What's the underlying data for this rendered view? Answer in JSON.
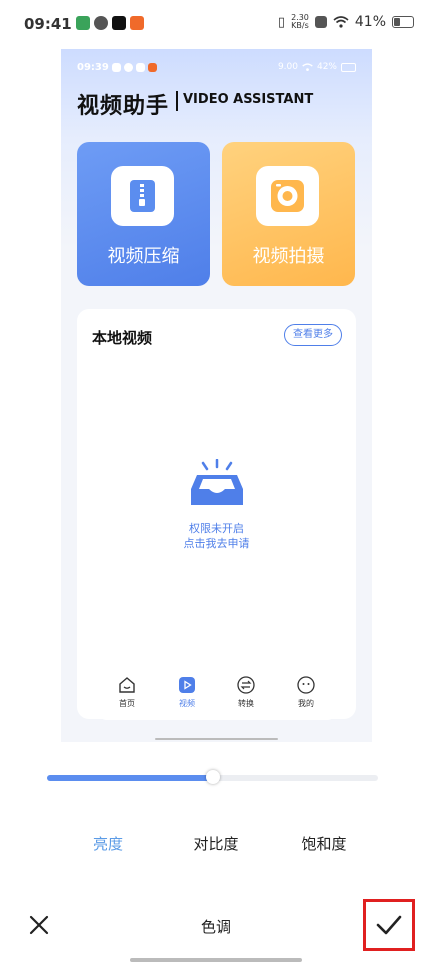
{
  "status_bar": {
    "time": "09:41",
    "net_speed_top": "2.30",
    "net_speed_bottom": "KB/s",
    "battery": "41%"
  },
  "preview": {
    "status_time": "09:39",
    "status_speed": "9.00",
    "status_battery": "42%",
    "app_title": "视频助手",
    "app_subtitle": "VIDEO ASSISTANT",
    "cards": [
      {
        "label": "视频压缩",
        "color": "#5b8def"
      },
      {
        "label": "视频拍摄",
        "color": "#ffc15e"
      }
    ],
    "local_video": {
      "title": "本地视频",
      "more_label": "查看更多",
      "empty_line1": "权限未开启",
      "empty_line2": "点击我去申请"
    },
    "tabs": [
      {
        "label": "首页",
        "icon": "home-face-icon"
      },
      {
        "label": "视频",
        "icon": "play-icon"
      },
      {
        "label": "转换",
        "icon": "swap-icon"
      },
      {
        "label": "我的",
        "icon": "profile-face-icon"
      }
    ]
  },
  "editor": {
    "slider_value": 0.5,
    "adjust_tabs": [
      {
        "label": "亮度",
        "active": true
      },
      {
        "label": "对比度",
        "active": false
      },
      {
        "label": "饱和度",
        "active": false
      }
    ],
    "mode_title": "色调",
    "accent_color": "#5b8def",
    "highlight_color": "#e02020"
  }
}
